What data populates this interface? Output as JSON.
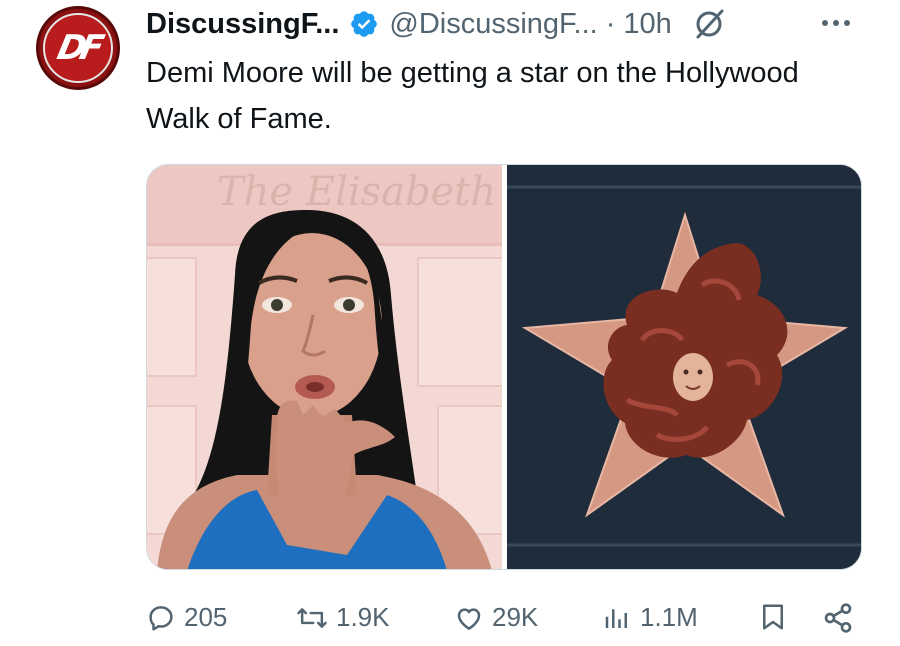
{
  "author": {
    "display_name": "DiscussingF...",
    "handle": "@DiscussingF...",
    "time": "10h",
    "avatar_text": "DF"
  },
  "tweet": {
    "text": "Demi Moore will be getting a star on the Hollywood Walk of Fame."
  },
  "media": {
    "left_image": "photo-woman-blowing-kiss",
    "right_image": "photo-walk-of-fame-star-with-sculpted-face",
    "left_background_text": "The Elisabeth"
  },
  "actions": {
    "replies": "205",
    "reposts": "1.9K",
    "likes": "29K",
    "views": "1.1M"
  },
  "colors": {
    "verified": "#1d9bf0",
    "muted": "#536471",
    "text": "#0f1419",
    "avatar": "#b81c1c"
  }
}
